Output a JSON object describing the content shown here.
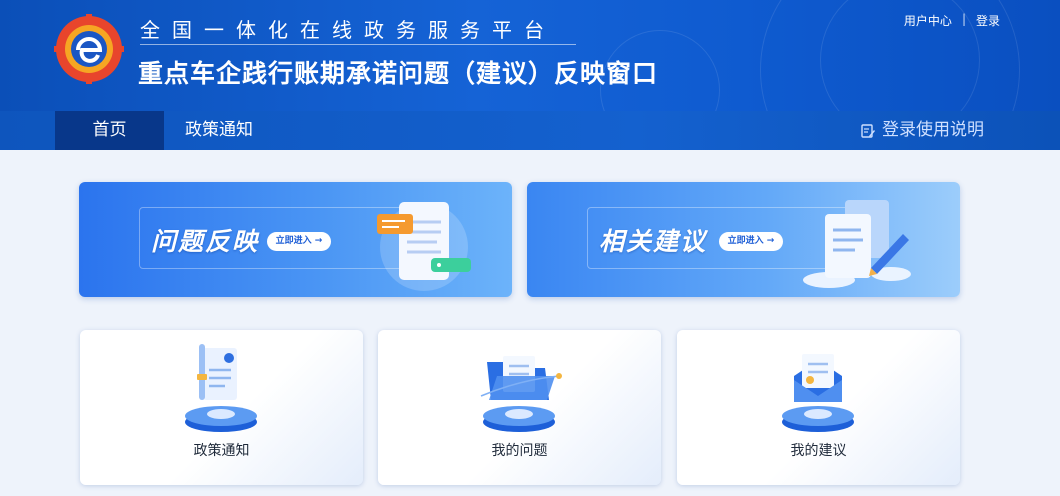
{
  "header": {
    "subtitle": "全国一体化在线政务服务平台",
    "title": "重点车企践行账期承诺问题（建议）反映窗口",
    "user_center": "用户中心",
    "separator": "|",
    "login": "登录"
  },
  "nav": {
    "home": "首页",
    "policy": "政策通知",
    "guide": "登录使用说明"
  },
  "banners": [
    {
      "title": "问题反映",
      "button": "立即进入 →"
    },
    {
      "title": "相关建议",
      "button": "立即进入 →"
    }
  ],
  "services": [
    {
      "label": "政策通知"
    },
    {
      "label": "我的问题"
    },
    {
      "label": "我的建议"
    }
  ],
  "colors": {
    "header_blue": "#1563d6",
    "nav_active": "#08378a",
    "page_bg": "#eef3fb"
  }
}
